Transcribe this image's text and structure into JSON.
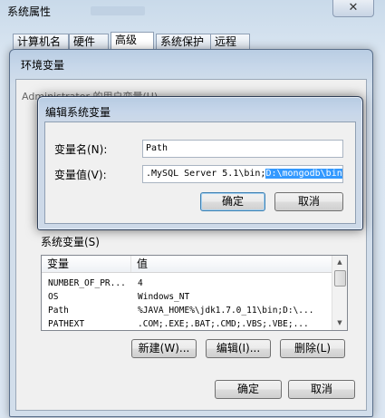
{
  "system_properties": {
    "title": "系统属性",
    "close_glyph": "✕",
    "tabs": [
      {
        "label": "计算机名"
      },
      {
        "label": "硬件"
      },
      {
        "label": "高级"
      },
      {
        "label": "系统保护"
      },
      {
        "label": "远程"
      }
    ]
  },
  "env_vars": {
    "title": "环境变量",
    "user_vars_label": "Administrator 的用户变量(U)",
    "system_vars_label": "系统变量(S)",
    "columns": [
      "变量",
      "值"
    ],
    "rows": [
      {
        "name": "NUMBER_OF_PR...",
        "value": "4"
      },
      {
        "name": "OS",
        "value": "Windows_NT"
      },
      {
        "name": "Path",
        "value": "%JAVA_HOME%\\jdk1.7.0_11\\bin;D:\\..."
      },
      {
        "name": "PATHEXT",
        "value": ".COM;.EXE;.BAT;.CMD;.VBS;.VBE;..."
      }
    ],
    "new_button": "新建(W)...",
    "edit_button": "编辑(I)...",
    "delete_button": "删除(L)",
    "ok_button": "确定",
    "cancel_button": "取消"
  },
  "edit_dialog": {
    "title": "编辑系统变量",
    "name_label": "变量名(N):",
    "name_value": "Path",
    "value_label": "变量值(V):",
    "value_plain": ".MySQL Server 5.1\\bin;",
    "value_selected": "D:\\mongodb\\bin",
    "ok_button": "确定",
    "cancel_button": "取消"
  }
}
